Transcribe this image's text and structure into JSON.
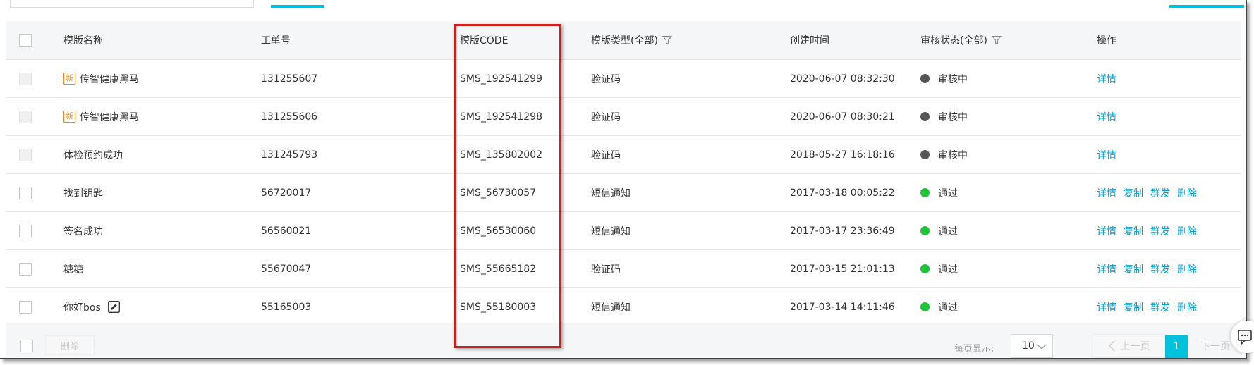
{
  "header": {
    "checkbox": "",
    "col_name": "模版名称",
    "col_order": "工单号",
    "col_code": "模版CODE",
    "col_type": "模版类型(全部)",
    "col_time": "创建时间",
    "col_status": "审核状态(全部)",
    "col_ops": "操作"
  },
  "rows": [
    {
      "name": "传智健康黑马",
      "is_new": true,
      "order": "131255607",
      "code": "SMS_192541299",
      "type": "验证码",
      "time": "2020-06-07 08:32:30",
      "status": "审核中",
      "status_color": "#555555"
    },
    {
      "name": "传智健康黑马",
      "is_new": true,
      "order": "131255606",
      "code": "SMS_192541298",
      "type": "验证码",
      "time": "2020-06-07 08:30:21",
      "status": "审核中",
      "status_color": "#555555"
    },
    {
      "name": "体检预约成功",
      "is_new": false,
      "order": "131245793",
      "code": "SMS_135802002",
      "type": "验证码",
      "time": "2018-05-27 16:18:16",
      "status": "审核中",
      "status_color": "#555555"
    },
    {
      "name": "找到钥匙",
      "is_new": false,
      "order": "56720017",
      "code": "SMS_56730057",
      "type": "短信通知",
      "time": "2017-03-18 00:05:22",
      "status": "通过",
      "status_color": "#1ec438"
    },
    {
      "name": "签名成功",
      "is_new": false,
      "order": "56560021",
      "code": "SMS_56530060",
      "type": "短信通知",
      "time": "2017-03-17 23:36:49",
      "status": "通过",
      "status_color": "#1ec438"
    },
    {
      "name": "糖糖",
      "is_new": false,
      "order": "55670047",
      "code": "SMS_55665182",
      "type": "验证码",
      "time": "2017-03-15 21:01:13",
      "status": "通过",
      "status_color": "#1ec438"
    },
    {
      "name": "你好bos",
      "is_new": false,
      "order": "55165003",
      "code": "SMS_55180003",
      "type": "短信通知",
      "time": "2017-03-14 14:11:46",
      "status": "通过",
      "status_color": "#1ec438"
    }
  ],
  "badges": {
    "new": "新"
  },
  "ops": {
    "detail": "详情",
    "copy": "复制",
    "send": "群发",
    "delete": "删除"
  },
  "footer": {
    "delete": "删除",
    "page_size_label": "每页显示:",
    "page_size": "10",
    "prev": "上一页",
    "current_page": "1",
    "next": "下一页"
  },
  "colors": {
    "accent": "#00c1de",
    "link": "#00a2d4",
    "highlight": "#d01c1c",
    "pending": "#555555",
    "passed": "#1ec438"
  }
}
